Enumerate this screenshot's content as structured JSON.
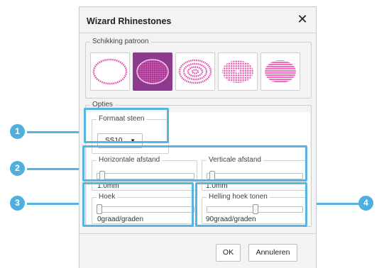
{
  "dialog": {
    "title": "Wizard Rhinestones",
    "close_label": "✕"
  },
  "pattern_group": {
    "legend": "Schikking patroon",
    "patterns": [
      {
        "name": "outline-oval",
        "selected": false
      },
      {
        "name": "filled-grid-oval",
        "selected": true
      },
      {
        "name": "concentric-oval",
        "selected": false
      },
      {
        "name": "radial-oval",
        "selected": false
      },
      {
        "name": "horizontal-rows-oval",
        "selected": false
      }
    ]
  },
  "options": {
    "legend": "Opties",
    "stone_size": {
      "legend": "Formaat steen",
      "value": "SS10"
    },
    "horizontal_spacing": {
      "legend": "Horizontale afstand",
      "value": "1.0mm"
    },
    "vertical_spacing": {
      "legend": "Verticale afstand",
      "value": "1.0mm"
    },
    "angle": {
      "legend": "Hoek",
      "value": "0graad/graden"
    },
    "show_slope_angle": {
      "legend": "Helling hoek tonen",
      "value": "90graad/graden"
    }
  },
  "buttons": {
    "ok": "OK",
    "cancel": "Annuleren"
  },
  "callouts": [
    "1",
    "2",
    "3",
    "4"
  ],
  "colors": {
    "accent": "#8c3a8e",
    "rhinestone": "#e04aa8",
    "highlight": "#55b6e2"
  }
}
